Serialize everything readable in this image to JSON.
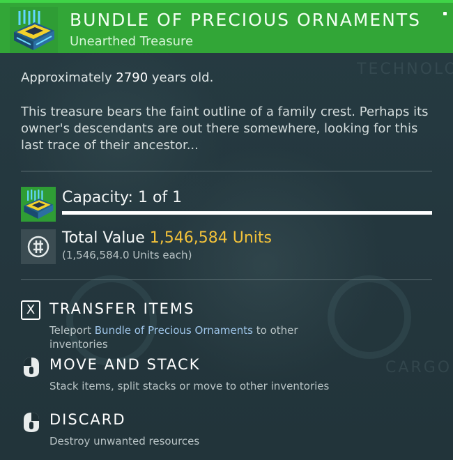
{
  "header": {
    "title": "BUNDLE OF PRECIOUS ORNAMENTS",
    "subtitle": "Unearthed Treasure",
    "accent_color": "#32a637",
    "icon": "treasure-crate-icon"
  },
  "background": {
    "ghost_text_1": "TECHNOLO",
    "ghost_text_2": "CARGO"
  },
  "info": {
    "age_prefix": "Approximately ",
    "age_value": "2790",
    "age_suffix": " years old.",
    "description": "This treasure bears the faint outline of a family crest. Perhaps its owner's descendants are out there somewhere, looking for this last trace of their ancestor..."
  },
  "capacity": {
    "label": "Capacity: 1 of 1",
    "fill_fraction": 1.0
  },
  "value": {
    "prefix": "Total Value ",
    "amount": "1,546,584 Units",
    "each": "(1,546,584.0 Units each)",
    "amount_color": "#f3c23a",
    "icon": "units-currency-icon"
  },
  "actions": {
    "transfer": {
      "key": "X",
      "label": "TRANSFER ITEMS",
      "help_prefix": "Teleport ",
      "help_item": "Bundle of Precious Ornaments",
      "help_suffix": " to other inventories"
    },
    "move": {
      "label": "MOVE AND STACK",
      "help": "Stack items, split stacks or move to other inventories",
      "icon": "mouse-left-click-icon"
    },
    "discard": {
      "label": "DISCARD",
      "help": "Destroy unwanted resources",
      "icon": "mouse-right-click-icon"
    }
  }
}
